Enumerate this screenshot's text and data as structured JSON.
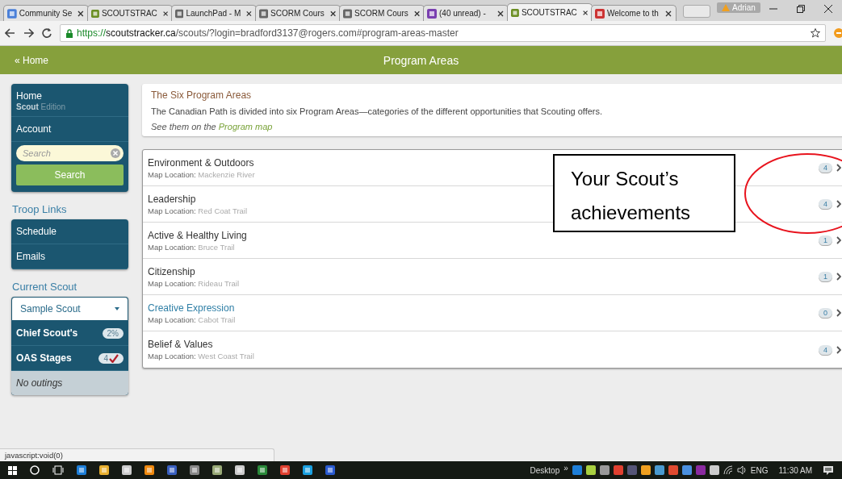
{
  "browser": {
    "tabs": [
      {
        "label": "Community Se",
        "selected": false
      },
      {
        "label": "SCOUTSTRAC",
        "selected": false
      },
      {
        "label": "LaunchPad - M",
        "selected": false
      },
      {
        "label": "SCORM Cours",
        "selected": false
      },
      {
        "label": "SCORM Cours",
        "selected": false
      },
      {
        "label": "(40 unread) -",
        "selected": false
      },
      {
        "label": "SCOUTSTRAC",
        "selected": true
      },
      {
        "label": "Welcome to th",
        "selected": false
      }
    ],
    "profile": "Adrian",
    "url": {
      "scheme": "https://",
      "host": "scoutstracker.ca",
      "path": "/scouts/?login=bradford3137@rogers.com#program-areas-master"
    }
  },
  "header": {
    "back_link": "« Home",
    "title": "Program Areas"
  },
  "sidebar": {
    "home": {
      "label": "Home",
      "edition": "**Scout** Edition"
    },
    "account": "Account",
    "search": {
      "placeholder": "Search",
      "button": "Search"
    },
    "troop_links": {
      "heading": "Troop Links",
      "items": [
        "Schedule",
        "Emails"
      ]
    },
    "current_scout": {
      "heading": "Current Scout",
      "selected_scout": "Sample Scout",
      "items": [
        {
          "label": "Chief Scout's",
          "badge": "2%",
          "checked": false
        },
        {
          "label": "OAS Stages",
          "badge": "4",
          "checked": true
        }
      ],
      "outings": "No outings"
    }
  },
  "intro": {
    "title": "The Six Program Areas",
    "text": "The Canadian Path is divided into six Program Areas—categories of the different opportunities that Scouting offers.",
    "note": "See them on the ",
    "link": "Program map"
  },
  "program_areas": [
    {
      "name": "Environment & Outdoors",
      "location": "**Map Location:** Mackenzie River",
      "count": "4",
      "highlighted": false
    },
    {
      "name": "Leadership",
      "location": "**Map Location:** Red Coat Trail",
      "count": "4",
      "highlighted": false
    },
    {
      "name": "Active & Healthy Living",
      "location": "**Map Location:** Bruce Trail",
      "count": "1",
      "highlighted": false
    },
    {
      "name": "Citizenship",
      "location": "**Map Location:** Rideau Trail",
      "count": "1",
      "highlighted": false
    },
    {
      "name": "Creative Expression",
      "location": "**Map Location:** Cabot Trail",
      "count": "0",
      "highlighted": true
    },
    {
      "name": "Belief & Values",
      "location": "**Map Location:** West Coast Trail",
      "count": "4",
      "highlighted": false
    }
  ],
  "annotation": {
    "text": "Your Scout’s achievements"
  },
  "status_bar": "javascript:void(0)",
  "taskbar": {
    "desktop": "Desktop",
    "overflow": "»",
    "language": "ENG",
    "time": "11:30 AM"
  }
}
